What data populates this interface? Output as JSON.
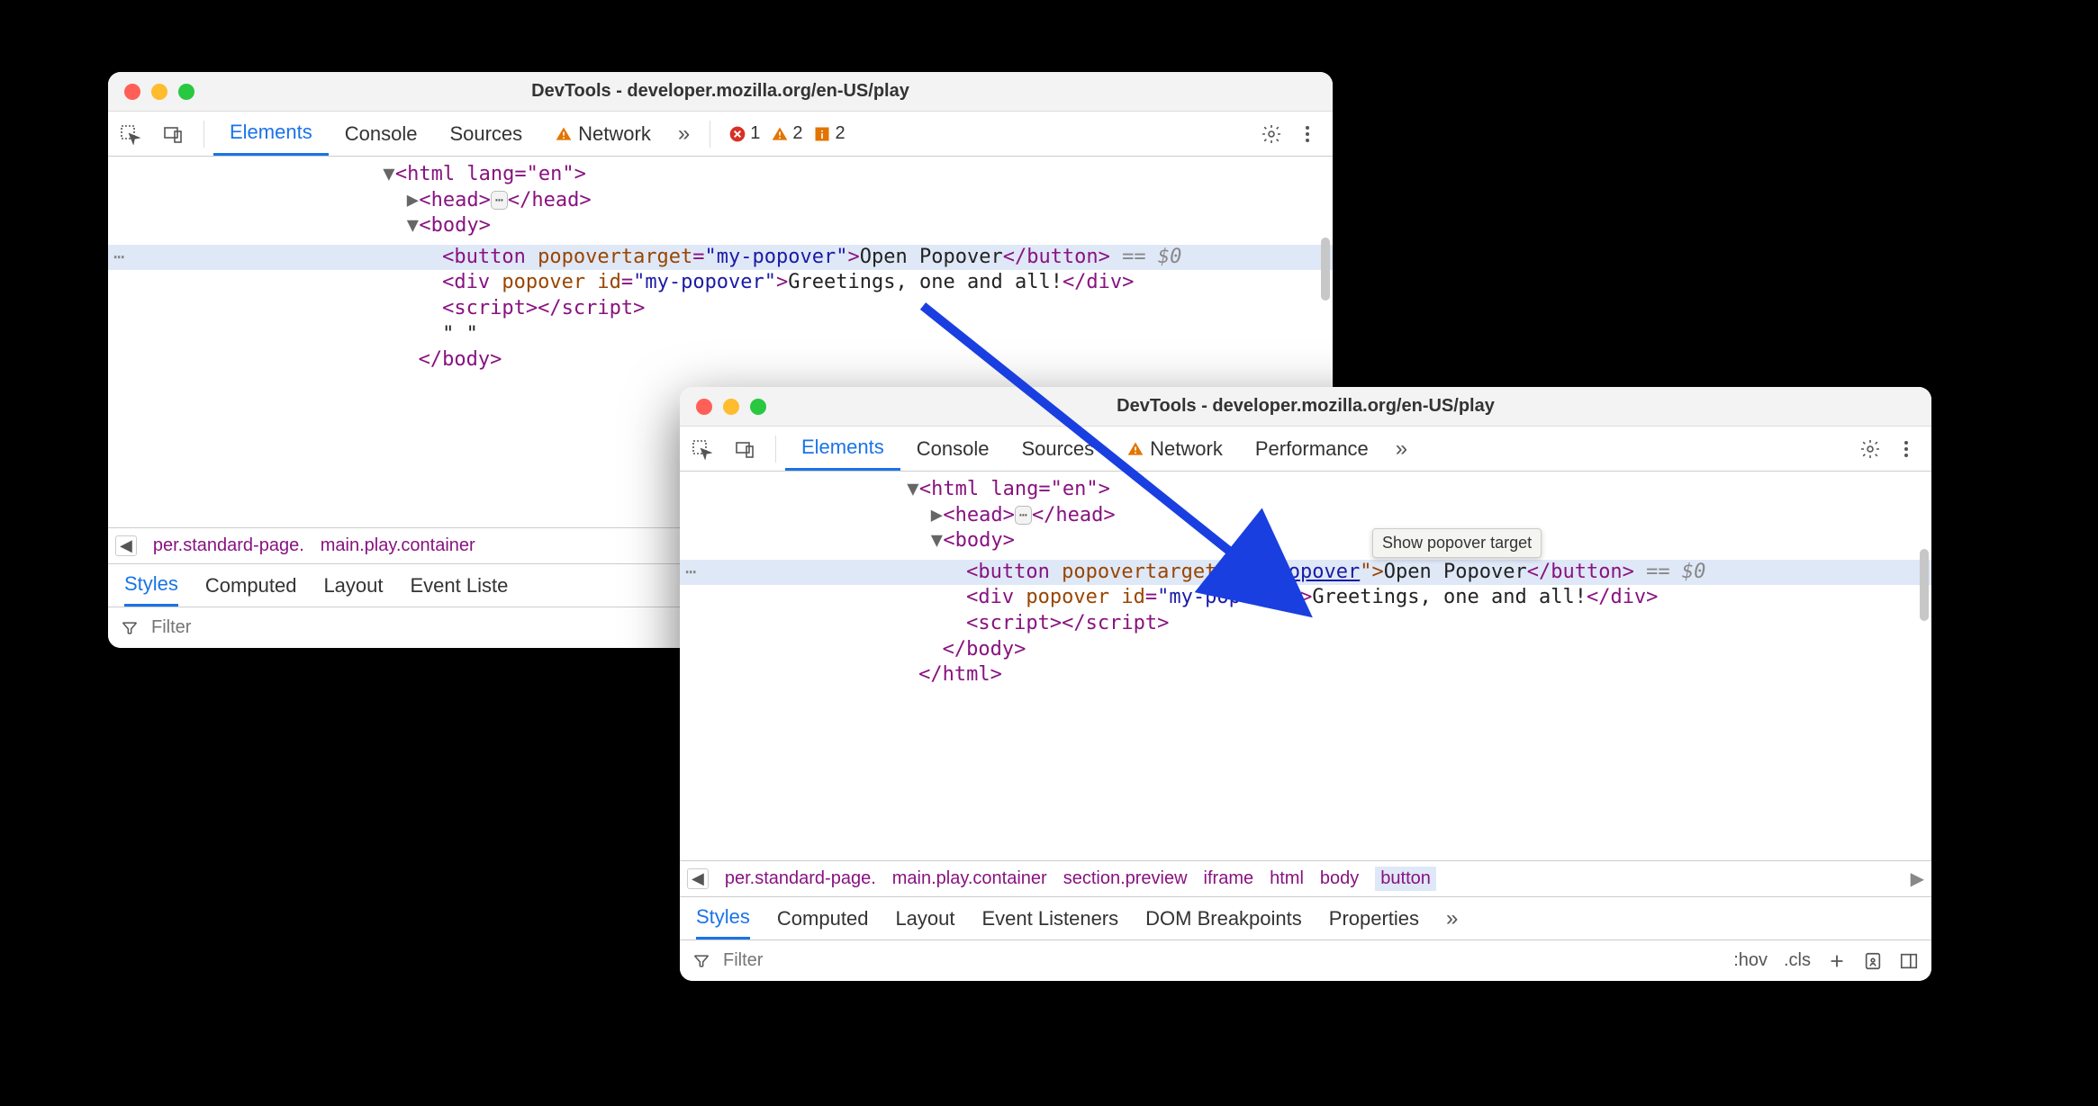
{
  "window1": {
    "title": "DevTools - developer.mozilla.org/en-US/play",
    "tabs": [
      "Elements",
      "Console",
      "Sources",
      "Network"
    ],
    "activeTab": "Elements",
    "errorCount": "1",
    "warnCount": "2",
    "infoCount": "2",
    "dom": {
      "htmlOpen": "<html lang=\"en\">",
      "headOpen": "<head>",
      "headClose": "</head>",
      "bodyOpen": "<body>",
      "buttonOpen": "<button ",
      "buttonAttr": "popovertarget",
      "buttonVal": "\"my-popover\"",
      "buttonText": "Open Popover",
      "buttonClose": "</button>",
      "eq0": " == $0",
      "divOpen": "<div ",
      "divAttr1": "popover",
      "divAttr2": "id",
      "divVal": "\"my-popover\"",
      "divText": "Greetings, one and all!",
      "divClose": "</div>",
      "scriptOpen": "<script>",
      "scriptClose": "</script>",
      "ws": "\" \"",
      "bodyClose": "</body>"
    },
    "breadcrumb": [
      "per.standard-page.",
      "main.play.container"
    ],
    "subTabs": [
      "Styles",
      "Computed",
      "Layout",
      "Event Liste"
    ],
    "filterPlaceholder": "Filter"
  },
  "window2": {
    "title": "DevTools - developer.mozilla.org/en-US/play",
    "tabs": [
      "Elements",
      "Console",
      "Sources",
      "Network",
      "Performance"
    ],
    "activeTab": "Elements",
    "tooltip": "Show popover target",
    "dom": {
      "htmlOpen": "<html lang=\"en\">",
      "headOpen": "<head>",
      "headClose": "</head>",
      "bodyOpen": "<body>",
      "buttonOpen": "<button ",
      "buttonAttr": "popovertarget",
      "buttonValQ1": "=\"",
      "buttonValLink": "my-popover",
      "buttonValQ2": "\">",
      "buttonText": "Open Popover",
      "buttonClose": "</button>",
      "eq0": " == $0",
      "divOpen": "<div ",
      "divAttr1": "popover",
      "divAttr2": "id",
      "divVal": "\"my-popover\"",
      "divText": "Greetings, one and all!",
      "divClose": "</div>",
      "scriptOpen": "<script>",
      "scriptClose": "</script>",
      "bodyClose": "</body>",
      "htmlClose": "</html>"
    },
    "breadcrumb": [
      "per.standard-page.",
      "main.play.container",
      "section.preview",
      "iframe",
      "html",
      "body",
      "button"
    ],
    "subTabs": [
      "Styles",
      "Computed",
      "Layout",
      "Event Listeners",
      "DOM Breakpoints",
      "Properties"
    ],
    "filterPlaceholder": "Filter",
    "hov": ":hov",
    "cls": ".cls"
  }
}
